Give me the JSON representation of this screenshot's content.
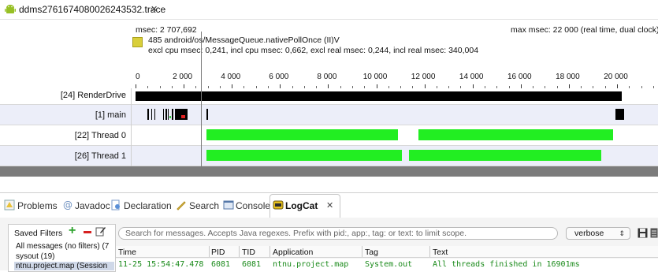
{
  "editor": {
    "tab_title": "ddms2761674080026243532.trace",
    "close_glyph": "✕",
    "icon": "android-icon"
  },
  "trace_header": {
    "msec": "msec: 2 707,692",
    "method": "485 android/os/MessageQueue.nativePollOnce (II)V",
    "details": "excl cpu msec: 0,241, incl cpu msec: 0,662, excl real msec: 0,244, incl real msec: 340,004",
    "max_msec": "max msec: 22 000 (real time, dual clock)",
    "legend_color": "#d9cf3a"
  },
  "timeline": {
    "axis_min": 0,
    "axis_max": 22000,
    "tick_labels": [
      "0",
      "2 000",
      "4 000",
      "6 000",
      "8 000",
      "10 000",
      "12 000",
      "14 000",
      "16 000",
      "18 000",
      "20 000"
    ],
    "tick_values": [
      0,
      2000,
      4000,
      6000,
      8000,
      10000,
      12000,
      14000,
      16000,
      18000,
      20000
    ],
    "cursor_msec": 2707.692,
    "threads": [
      {
        "name": "[24] RenderDrive",
        "segments": [
          {
            "start": 0,
            "end": 20200,
            "color": "#000000"
          }
        ]
      },
      {
        "name": "[1] main",
        "segments": [
          {
            "start": 500,
            "end": 560,
            "color": "#000000"
          },
          {
            "start": 640,
            "end": 700,
            "color": "#000000"
          },
          {
            "start": 780,
            "end": 830,
            "color": "#000000"
          },
          {
            "start": 1130,
            "end": 1180,
            "color": "#000000"
          },
          {
            "start": 1260,
            "end": 1300,
            "color": "#000000"
          },
          {
            "start": 1340,
            "end": 1380,
            "color": "#000000"
          },
          {
            "start": 1420,
            "end": 1470,
            "color": "#2ecc40"
          },
          {
            "start": 1500,
            "end": 1560,
            "color": "#000000"
          },
          {
            "start": 1640,
            "end": 2150,
            "color": "#000000"
          },
          {
            "start": 1900,
            "end": 2050,
            "color": "#e02020"
          },
          {
            "start": 2950,
            "end": 3000,
            "color": "#000000"
          },
          {
            "start": 19950,
            "end": 20300,
            "color": "#000000"
          }
        ]
      },
      {
        "name": "[22] Thread 0",
        "segments": [
          {
            "start": 2950,
            "end": 10900,
            "color": "#22ee22"
          },
          {
            "start": 11750,
            "end": 19850,
            "color": "#22ee22"
          }
        ]
      },
      {
        "name": "[26] Thread 1",
        "segments": [
          {
            "start": 2950,
            "end": 11050,
            "color": "#22ee22"
          },
          {
            "start": 11350,
            "end": 19350,
            "color": "#22ee22"
          }
        ]
      }
    ]
  },
  "views": {
    "tabs": [
      {
        "label": "Problems",
        "icon": "problems-icon",
        "active": false
      },
      {
        "label": "Javadoc",
        "icon": "at-sign-icon",
        "active": false
      },
      {
        "label": "Declaration",
        "icon": "declaration-icon",
        "active": false
      },
      {
        "label": "Search",
        "icon": "flashlight-icon",
        "active": false
      },
      {
        "label": "Console",
        "icon": "console-icon",
        "active": false
      },
      {
        "label": "LogCat",
        "icon": "logcat-icon",
        "active": true
      }
    ],
    "close_glyph": "✕"
  },
  "logcat": {
    "saved_filters_label": "Saved Filters",
    "filters": [
      "All messages (no filters) (7",
      "sysout (19)",
      "ntnu.project.map (Session"
    ],
    "search_placeholder": "Search for messages. Accepts Java regexes. Prefix with pid:, app:, tag: or text: to limit scope.",
    "level": "verbose",
    "columns": [
      "Time",
      "PID",
      "TID",
      "Application",
      "Tag",
      "Text"
    ],
    "rows": [
      {
        "time": "11-25 15:54:47.478",
        "pid": "6081",
        "tid": "6081",
        "application": "ntnu.project.map",
        "tag": "System.out",
        "text": "All threads finished in 16901ms"
      }
    ],
    "message_color": "#1a8a1a"
  }
}
